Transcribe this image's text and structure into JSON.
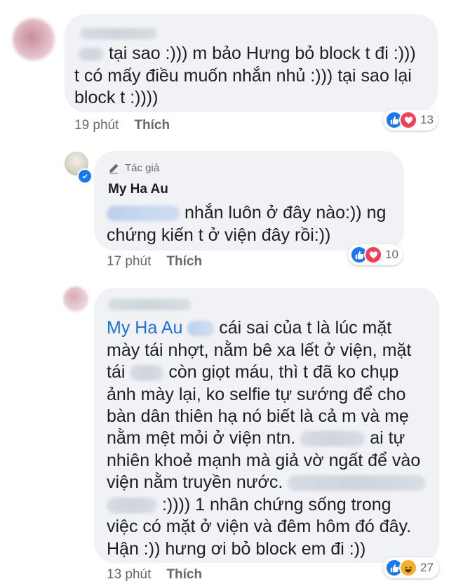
{
  "comments": [
    {
      "lines": [
        "tại sao :))) m bảo Hưng bỏ block t đi :)))",
        "t có mấy điều muốn nhắn nhủ :))) tại sao lại",
        "block t :))))"
      ],
      "time": "19 phút",
      "like_label": "Thích",
      "reaction_count": "13",
      "reactions": [
        "like-icon",
        "love-icon"
      ]
    },
    {
      "author_badge": "Tác giả",
      "author_name": "My Ha Au",
      "lines": [
        "nhắn luôn ở đây nào:)) ng",
        "chứng kiến t ở viện đây rồi:))"
      ],
      "time": "17 phút",
      "like_label": "Thích",
      "reaction_count": "10",
      "reactions": [
        "like-icon",
        "love-icon"
      ]
    },
    {
      "mention": "My Ha Au",
      "lines": [
        "cái sai của t là lúc mặt",
        "mày tái nhợt, nằm bê xa lết ở viện, mặt",
        "tái",
        "còn giọt máu, thì t đã ko chụp",
        "ảnh mày lại, ko selfie tự sướng để cho",
        "bàn dân thiên hạ nó biết là cả m và mẹ",
        "nằm mệt mỏi ở viện ntn.",
        "ai tự",
        "nhiên khoẻ mạnh mà giả vờ ngất để vào",
        "viện nằm truyền nước.",
        ":)))) 1 nhân chứng sống trong",
        "việc có mặt ở viện và đêm hôm đó đây.",
        "Hận :)) hưng ơi bỏ block em đi :))"
      ],
      "time": "13 phút",
      "like_label": "Thích",
      "reaction_count": "27",
      "reactions": [
        "like-icon",
        "haha-icon"
      ]
    }
  ],
  "colors": {
    "bubble": "#f0f2f5",
    "like_blue": "#1877f2",
    "love_red": "#f33e58",
    "haha_yellow": "#f7b125",
    "mention_blue": "#216fdb",
    "meta_gray": "#65676b"
  }
}
